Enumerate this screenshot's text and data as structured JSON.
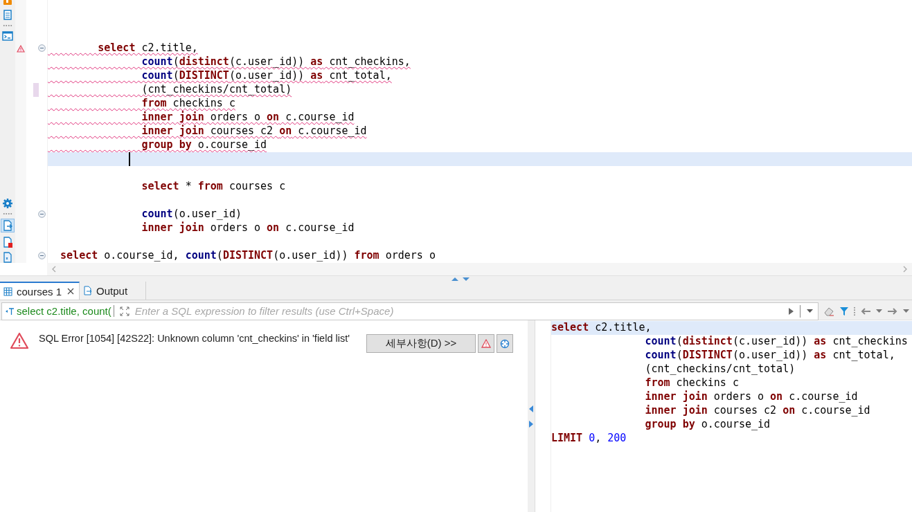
{
  "editor": {
    "lines": [
      {
        "current": false,
        "fold": false,
        "warning": false,
        "changed": false
      },
      {
        "current": false,
        "fold": false,
        "warning": false,
        "changed": false
      },
      {
        "current": false,
        "fold": false,
        "warning": false,
        "changed": false
      },
      {
        "tokens": [
          {
            "kind": "kw",
            "t": "        select"
          },
          {
            "kind": "text",
            "t": " c2.title,"
          }
        ],
        "error": true,
        "current": false,
        "fold": true,
        "warning": true,
        "changed": false
      },
      {
        "tokens": [
          {
            "kind": "fn",
            "t": "               count"
          },
          {
            "kind": "text",
            "t": "("
          },
          {
            "kind": "kw",
            "t": "distinct"
          },
          {
            "kind": "text",
            "t": "(c.user_id)) "
          },
          {
            "kind": "kw",
            "t": "as"
          },
          {
            "kind": "text",
            "t": " cnt_checkins,"
          }
        ],
        "error": true,
        "current": false,
        "fold": false,
        "warning": false,
        "changed": false
      },
      {
        "tokens": [
          {
            "kind": "fn",
            "t": "               count"
          },
          {
            "kind": "text",
            "t": "("
          },
          {
            "kind": "kw",
            "t": "DISTINCT"
          },
          {
            "kind": "text",
            "t": "(o.user_id)) "
          },
          {
            "kind": "kw",
            "t": "as"
          },
          {
            "kind": "text",
            "t": " cnt_total,"
          }
        ],
        "error": true,
        "current": false,
        "fold": false,
        "warning": false,
        "changed": false
      },
      {
        "tokens": [
          {
            "kind": "text",
            "t": "               (cnt_checkins/cnt_total)"
          }
        ],
        "error": true,
        "current": false,
        "fold": false,
        "warning": false,
        "changed": true
      },
      {
        "tokens": [
          {
            "kind": "kw",
            "t": "               from"
          },
          {
            "kind": "text",
            "t": " checkins c"
          }
        ],
        "error": true,
        "current": false,
        "fold": false,
        "warning": false,
        "changed": false
      },
      {
        "tokens": [
          {
            "kind": "kw",
            "t": "               inner join"
          },
          {
            "kind": "text",
            "t": " orders o "
          },
          {
            "kind": "kw",
            "t": "on"
          },
          {
            "kind": "text",
            "t": " c.course_id"
          }
        ],
        "error": true,
        "current": false,
        "fold": false,
        "warning": false,
        "changed": false
      },
      {
        "tokens": [
          {
            "kind": "kw",
            "t": "               inner join"
          },
          {
            "kind": "text",
            "t": " courses c2 "
          },
          {
            "kind": "kw",
            "t": "on"
          },
          {
            "kind": "text",
            "t": " c.course_id"
          }
        ],
        "error": true,
        "current": false,
        "fold": false,
        "warning": false,
        "changed": false
      },
      {
        "tokens": [
          {
            "kind": "kw",
            "t": "               group by"
          },
          {
            "kind": "text",
            "t": " o.course_id"
          }
        ],
        "error": true,
        "current": false,
        "fold": false,
        "warning": false,
        "changed": false
      },
      {
        "current": true,
        "fold": false,
        "warning": false,
        "changed": false
      },
      {
        "current": false,
        "fold": false,
        "warning": false,
        "changed": false
      },
      {
        "tokens": [
          {
            "kind": "kw",
            "t": "               select"
          },
          {
            "kind": "text",
            "t": " * "
          },
          {
            "kind": "kw",
            "t": "from"
          },
          {
            "kind": "text",
            "t": " courses c"
          }
        ],
        "error": false,
        "current": false,
        "fold": false,
        "warning": false,
        "changed": false
      },
      {
        "current": false,
        "fold": false,
        "warning": false,
        "changed": false
      },
      {
        "tokens": [
          {
            "kind": "fn",
            "t": "               count"
          },
          {
            "kind": "text",
            "t": "(o.user_id)"
          }
        ],
        "error": false,
        "current": false,
        "fold": true,
        "warning": false,
        "changed": false
      },
      {
        "tokens": [
          {
            "kind": "kw",
            "t": "               inner join"
          },
          {
            "kind": "text",
            "t": " orders o "
          },
          {
            "kind": "kw",
            "t": "on"
          },
          {
            "kind": "text",
            "t": " c.course_id"
          }
        ],
        "error": false,
        "current": false,
        "fold": false,
        "warning": false,
        "changed": false
      },
      {
        "current": false,
        "fold": false,
        "warning": false,
        "changed": false
      },
      {
        "tokens": [
          {
            "kind": "kw",
            "t": "  select"
          },
          {
            "kind": "text",
            "t": " o.course_id, "
          },
          {
            "kind": "fn",
            "t": "count"
          },
          {
            "kind": "text",
            "t": "("
          },
          {
            "kind": "kw",
            "t": "DISTINCT"
          },
          {
            "kind": "text",
            "t": "(o.user_id)) "
          },
          {
            "kind": "kw",
            "t": "from"
          },
          {
            "kind": "text",
            "t": " orders o"
          }
        ],
        "error": false,
        "current": false,
        "fold": true,
        "warning": false,
        "changed": false
      }
    ]
  },
  "tabs": [
    {
      "label": "courses 1",
      "selected": true,
      "closable": true
    },
    {
      "label": "Output",
      "selected": false,
      "closable": false
    }
  ],
  "filter": {
    "query": "select c2.title, count(",
    "placeholder": "Enter a SQL expression to filter results (use Ctrl+Space)"
  },
  "error_panel": {
    "message": "SQL Error [1054] [42S22]: Unknown column 'cnt_checkins' in 'field list'",
    "details_button": "세부사항(D) >>"
  },
  "query_text": {
    "lines": [
      {
        "tokens": [
          {
            "kind": "kw",
            "t": "select"
          },
          {
            "kind": "text",
            "t": " c2.title,"
          }
        ],
        "current": true
      },
      {
        "tokens": [
          {
            "kind": "fn",
            "t": "               count"
          },
          {
            "kind": "text",
            "t": "("
          },
          {
            "kind": "kw",
            "t": "distinct"
          },
          {
            "kind": "text",
            "t": "(c.user_id)) "
          },
          {
            "kind": "kw",
            "t": "as"
          },
          {
            "kind": "text",
            "t": " cnt_checkins"
          }
        ],
        "current": false
      },
      {
        "tokens": [
          {
            "kind": "fn",
            "t": "               count"
          },
          {
            "kind": "text",
            "t": "("
          },
          {
            "kind": "kw",
            "t": "DISTINCT"
          },
          {
            "kind": "text",
            "t": "(o.user_id)) "
          },
          {
            "kind": "kw",
            "t": "as"
          },
          {
            "kind": "text",
            "t": " cnt_total,"
          }
        ],
        "current": false
      },
      {
        "tokens": [
          {
            "kind": "text",
            "t": "               (cnt_checkins/cnt_total)"
          }
        ],
        "current": false
      },
      {
        "tokens": [
          {
            "kind": "kw",
            "t": "               from"
          },
          {
            "kind": "text",
            "t": " checkins c"
          }
        ],
        "current": false
      },
      {
        "tokens": [
          {
            "kind": "kw",
            "t": "               inner join"
          },
          {
            "kind": "text",
            "t": " orders o "
          },
          {
            "kind": "kw",
            "t": "on"
          },
          {
            "kind": "text",
            "t": " c.course_id"
          }
        ],
        "current": false
      },
      {
        "tokens": [
          {
            "kind": "kw",
            "t": "               inner join"
          },
          {
            "kind": "text",
            "t": " courses c2 "
          },
          {
            "kind": "kw",
            "t": "on"
          },
          {
            "kind": "text",
            "t": " c.course_id"
          }
        ],
        "current": false
      },
      {
        "tokens": [
          {
            "kind": "kw",
            "t": "               group by"
          },
          {
            "kind": "text",
            "t": " o.course_id"
          }
        ],
        "current": false
      },
      {
        "tokens": [
          {
            "kind": "kw",
            "t": "LIMIT "
          },
          {
            "kind": "num",
            "t": "0"
          },
          {
            "kind": "text",
            "t": ", "
          },
          {
            "kind": "num",
            "t": "200"
          }
        ],
        "current": false
      }
    ]
  }
}
